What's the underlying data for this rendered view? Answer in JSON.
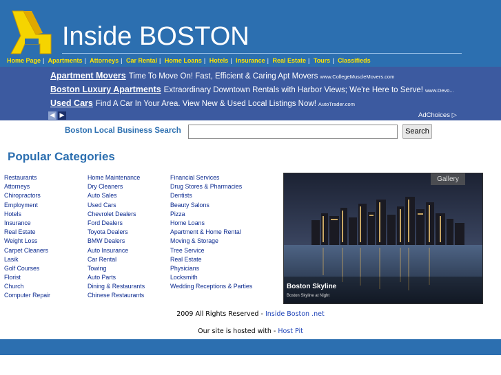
{
  "header": {
    "title": "Inside BOSTON"
  },
  "nav": [
    "Home Page",
    "Apartments",
    "Attorneys",
    "Car Rental",
    "Home Loans",
    "Hotels",
    "Insurance",
    "Real Estate",
    "Tours",
    "Classifieds"
  ],
  "ads": [
    {
      "title": "Apartment Movers",
      "text": "Time To Move On! Fast, Efficient & Caring Apt Movers",
      "url": "www.CollegeMuscleMovers.com"
    },
    {
      "title": "Boston Luxury Apartments",
      "text": "Extraordinary Downtown Rentals with Harbor Views; We're Here to Serve!",
      "url": "www.Devo..."
    },
    {
      "title": "Used Cars",
      "text": "Find A Car In Your Area. View New & Used Local Listings Now!",
      "url": "AutoTrader.com"
    }
  ],
  "adchoices": "AdChoices ▷",
  "search": {
    "label": "Boston Local Business Search",
    "button": "Search",
    "value": ""
  },
  "popular_title": "Popular Categories",
  "categories": {
    "col1": [
      "Restaurants",
      "Attorneys",
      "Chiropractors",
      "Employment",
      "Hotels",
      "Insurance",
      "Real Estate",
      "Weight Loss",
      "Carpet Cleaners",
      "Lasik",
      "Golf Courses",
      "Florist",
      "Church",
      "Computer Repair"
    ],
    "col2": [
      "Home Maintenance",
      "Dry Cleaners",
      "Auto Sales",
      "Used Cars",
      "Chevrolet Dealers",
      "Ford Dealers",
      "Toyota Dealers",
      "BMW Dealers",
      "Auto Insurance",
      "Car Rental",
      "Towing",
      "Auto Parts",
      "Dining & Restaurants",
      "Chinese Restaurants"
    ],
    "col3": [
      "Financial Services",
      "Drug Stores & Pharmacies",
      "Dentists",
      "Beauty Salons",
      "Pizza",
      "Home Loans",
      "Apartment & Home Rental",
      "Moving & Storage",
      "Tree Service",
      "Real Estate",
      "Physicians",
      "Locksmith",
      "Wedding Receptions & Parties"
    ]
  },
  "gallery": {
    "tag": "Gallery",
    "caption_title": "Boston Skyline",
    "caption_sub": "Boston Skyline at Night"
  },
  "footer": {
    "copyright": "2009 All Rights Reserved - ",
    "site_link": "Inside Boston .net",
    "hosted": "Our site is hosted with - ",
    "host_link": "Host Pit"
  },
  "colors": {
    "brand_blue": "#2c6fb0",
    "ad_band": "#3c5aa0",
    "nav_yellow": "#ffe400"
  }
}
